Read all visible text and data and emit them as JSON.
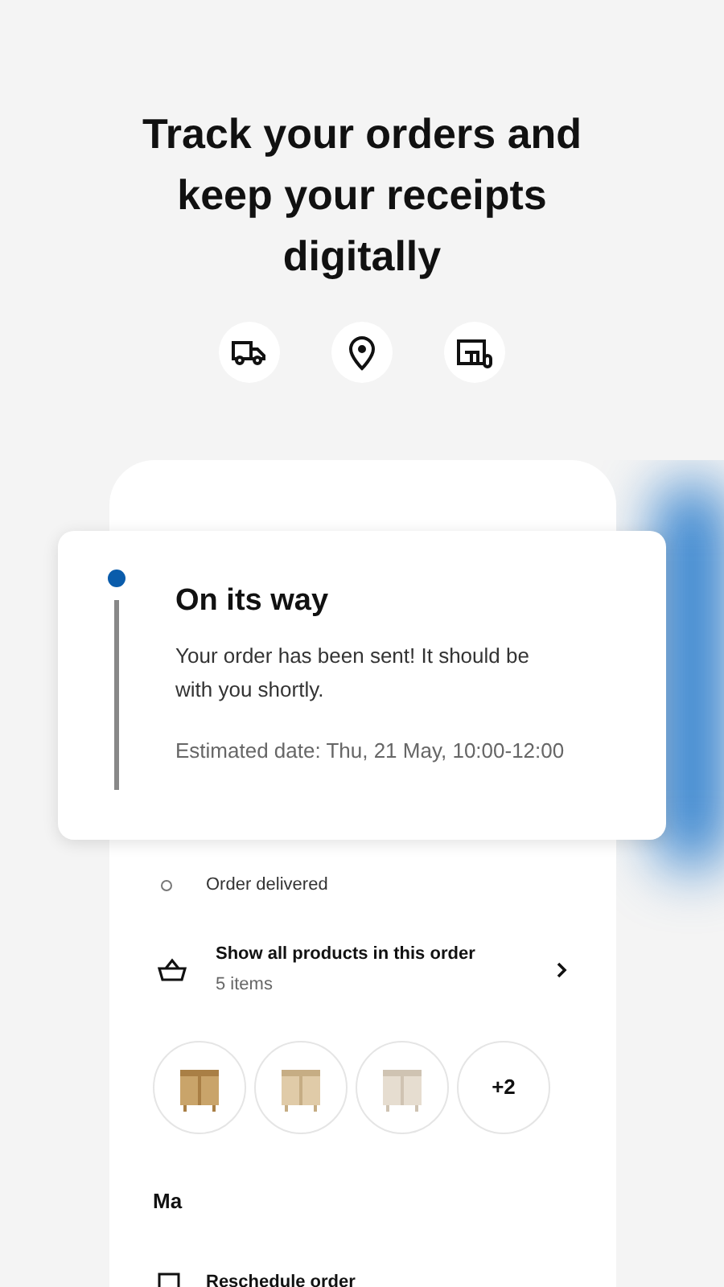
{
  "headline": "Track your orders and keep your receipts digitally",
  "status_card": {
    "title": "On its way",
    "message": "Your order has been sent! It should be with you shortly.",
    "estimate": "Estimated date: Thu, 21 May, 10:00-12:00",
    "current": true
  },
  "timeline": [
    {
      "label": "Order delivered",
      "done": false
    }
  ],
  "products_row": {
    "title": "Show all products in this order",
    "subtitle": "5 items"
  },
  "thumbnails": [
    {
      "kind": "picture"
    },
    {
      "kind": "picture"
    },
    {
      "kind": "picture"
    },
    {
      "kind": "more",
      "label": "+2"
    }
  ],
  "section_heading": "Ma",
  "actions": [
    {
      "label": "Reschedule order"
    }
  ]
}
